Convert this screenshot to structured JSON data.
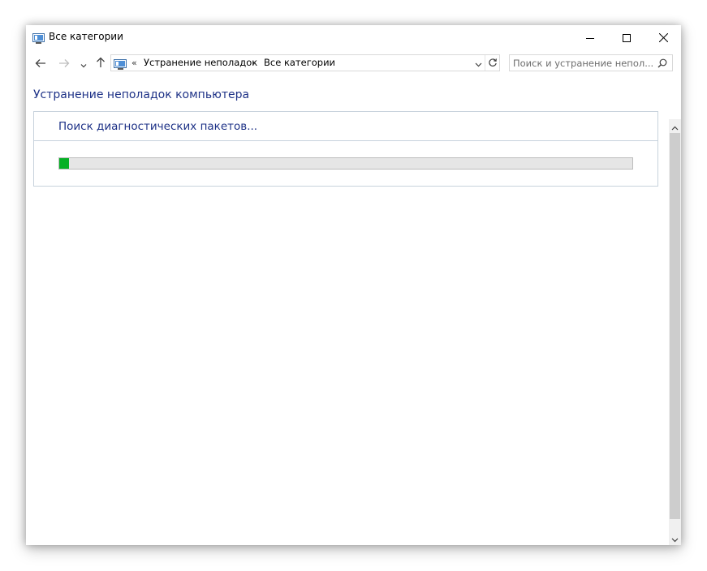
{
  "window": {
    "title": "Все категории",
    "controls": {
      "minimize_icon": "minimize-icon",
      "maximize_icon": "maximize-icon",
      "close_icon": "close-icon"
    }
  },
  "nav": {
    "back_icon": "arrow-left-icon",
    "forward_icon": "arrow-right-icon",
    "recent_icon": "chevron-down-icon",
    "up_icon": "arrow-up-icon"
  },
  "address": {
    "overflow": "«",
    "breadcrumbs": [
      {
        "label": "Устранение неполадок"
      },
      {
        "label": "Все категории"
      }
    ],
    "separator": "›",
    "dropdown_icon": "chevron-down-icon",
    "refresh_icon": "refresh-icon"
  },
  "search": {
    "placeholder": "Поиск и устранение непол...",
    "value": "",
    "icon": "search-icon"
  },
  "content": {
    "heading": "Устранение неполадок компьютера",
    "panel_title": "Поиск диагностических пакетов...",
    "progress_fraction": 0.017
  },
  "colors": {
    "link_blue": "#1e3287",
    "progress_green": "#06b025",
    "progress_track": "#e6e6e6",
    "panel_border": "#c7d2dc"
  }
}
